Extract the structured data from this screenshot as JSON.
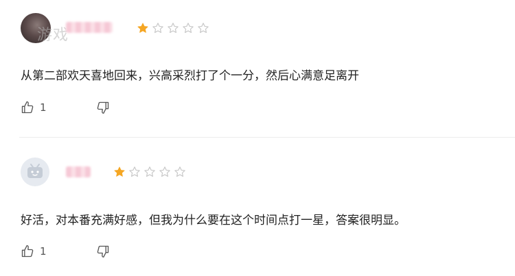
{
  "reviews": [
    {
      "watermark": "游戏",
      "rating": 1,
      "max_rating": 5,
      "comment": "从第二部欢天喜地回来，兴高采烈打了个一分，然后心满意足离开",
      "likes": "1"
    },
    {
      "rating": 1,
      "max_rating": 5,
      "comment": "好活，对本番充满好感，但我为什么要在这个时间点打一星，答案很明显。",
      "likes": "1"
    }
  ],
  "colors": {
    "star_filled": "#f5a623",
    "star_empty": "#c8c8c8",
    "icon": "#555555"
  }
}
